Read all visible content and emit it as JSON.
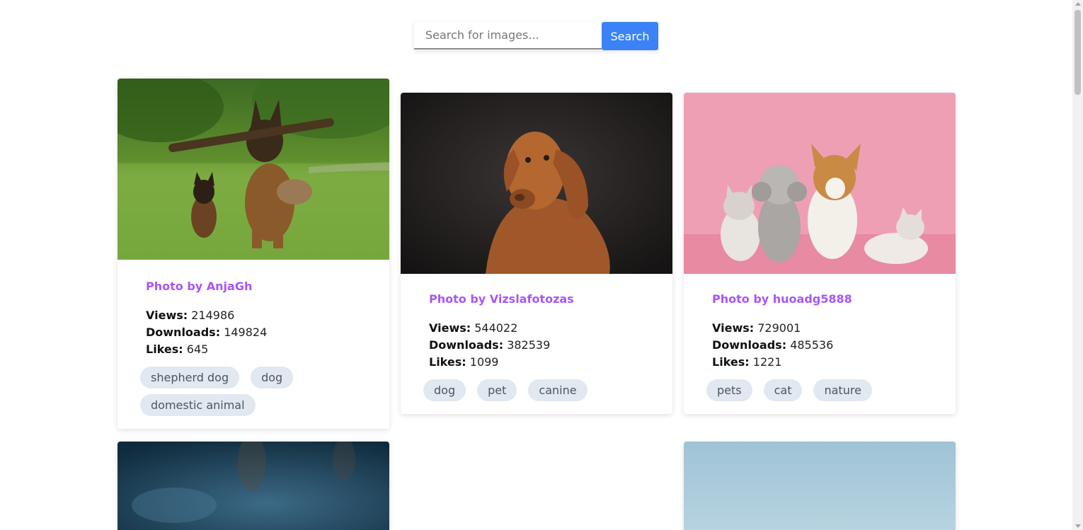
{
  "search": {
    "placeholder": "Search for images...",
    "button_label": "Search"
  },
  "cards": [
    {
      "author": "Photo by AnjaGh",
      "views_label": "Views:",
      "views": "214986",
      "downloads_label": "Downloads:",
      "downloads": "149824",
      "likes_label": "Likes:",
      "likes": "645",
      "tags": [
        "shepherd dog",
        "dog",
        "domestic animal"
      ]
    },
    {
      "author": "Photo by Vizslafotozas",
      "views_label": "Views:",
      "views": "544022",
      "downloads_label": "Downloads:",
      "downloads": "382539",
      "likes_label": "Likes:",
      "likes": "1099",
      "tags": [
        "dog",
        "pet",
        "canine"
      ]
    },
    {
      "author": "Photo by huoadg5888",
      "views_label": "Views:",
      "views": "729001",
      "downloads_label": "Downloads:",
      "downloads": "485536",
      "likes_label": "Likes:",
      "likes": "1221",
      "tags": [
        "pets",
        "cat",
        "nature"
      ]
    }
  ],
  "colors": {
    "accent": "#3b82f6",
    "author": "#a855f7",
    "tag_bg": "#e2e8f0"
  }
}
